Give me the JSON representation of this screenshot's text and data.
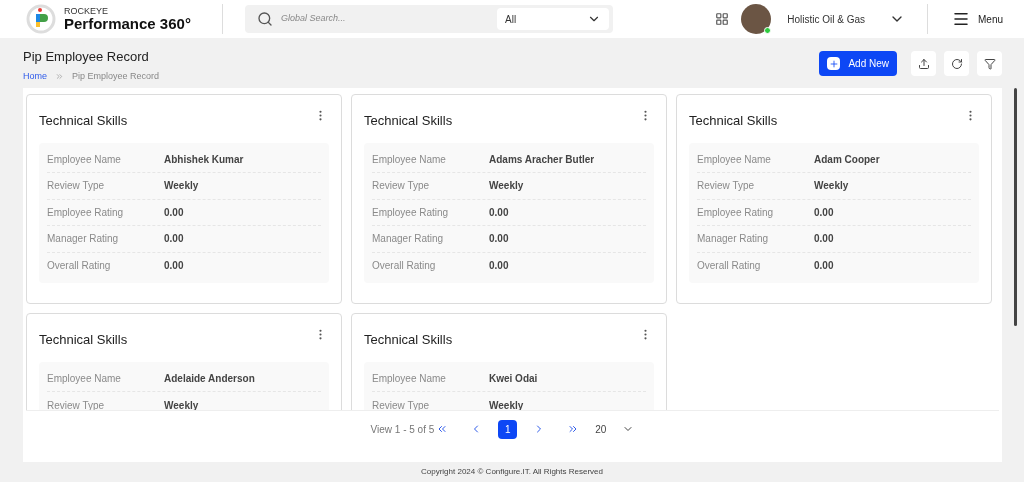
{
  "brand": {
    "top": "ROCKEYE",
    "name": "Performance 360°"
  },
  "search": {
    "placeholder": "Global Search...",
    "scope": "All"
  },
  "company": {
    "name": "Holistic Oil & Gas",
    "online": true
  },
  "menu": {
    "label": "Menu"
  },
  "page": {
    "title": "Pip Employee Record",
    "breadcrumb": [
      {
        "label": "Home",
        "link": true
      },
      {
        "label": "Pip Employee Record",
        "link": false
      }
    ]
  },
  "actions": {
    "add": "Add New"
  },
  "cards": [
    {
      "title": "Technical Skills",
      "fields": [
        {
          "label": "Employee Name",
          "value": "Abhishek Kumar"
        },
        {
          "label": "Review Type",
          "value": "Weekly"
        },
        {
          "label": "Employee Rating",
          "value": "0.00"
        },
        {
          "label": "Manager Rating",
          "value": "0.00"
        },
        {
          "label": "Overall Rating",
          "value": "0.00"
        }
      ]
    },
    {
      "title": "Technical Skills",
      "fields": [
        {
          "label": "Employee Name",
          "value": "Adams Aracher Butler"
        },
        {
          "label": "Review Type",
          "value": "Weekly"
        },
        {
          "label": "Employee Rating",
          "value": "0.00"
        },
        {
          "label": "Manager Rating",
          "value": "0.00"
        },
        {
          "label": "Overall Rating",
          "value": "0.00"
        }
      ]
    },
    {
      "title": "Technical Skills",
      "fields": [
        {
          "label": "Employee Name",
          "value": "Adam Cooper"
        },
        {
          "label": "Review Type",
          "value": "Weekly"
        },
        {
          "label": "Employee Rating",
          "value": "0.00"
        },
        {
          "label": "Manager Rating",
          "value": "0.00"
        },
        {
          "label": "Overall Rating",
          "value": "0.00"
        }
      ]
    },
    {
      "title": "Technical Skills",
      "fields": [
        {
          "label": "Employee Name",
          "value": "Adelaide Anderson"
        },
        {
          "label": "Review Type",
          "value": "Weekly"
        }
      ]
    },
    {
      "title": "Technical Skills",
      "fields": [
        {
          "label": "Employee Name",
          "value": "Kwei Odai"
        },
        {
          "label": "Review Type",
          "value": "Weekly"
        }
      ]
    }
  ],
  "pagination": {
    "summary": "View 1 - 5 of 5",
    "pages": [
      {
        "label": "1",
        "selected": true
      }
    ],
    "page_size": "20"
  },
  "footer": "Copyright 2024 © Configure.IT. All Rights Reserved"
}
